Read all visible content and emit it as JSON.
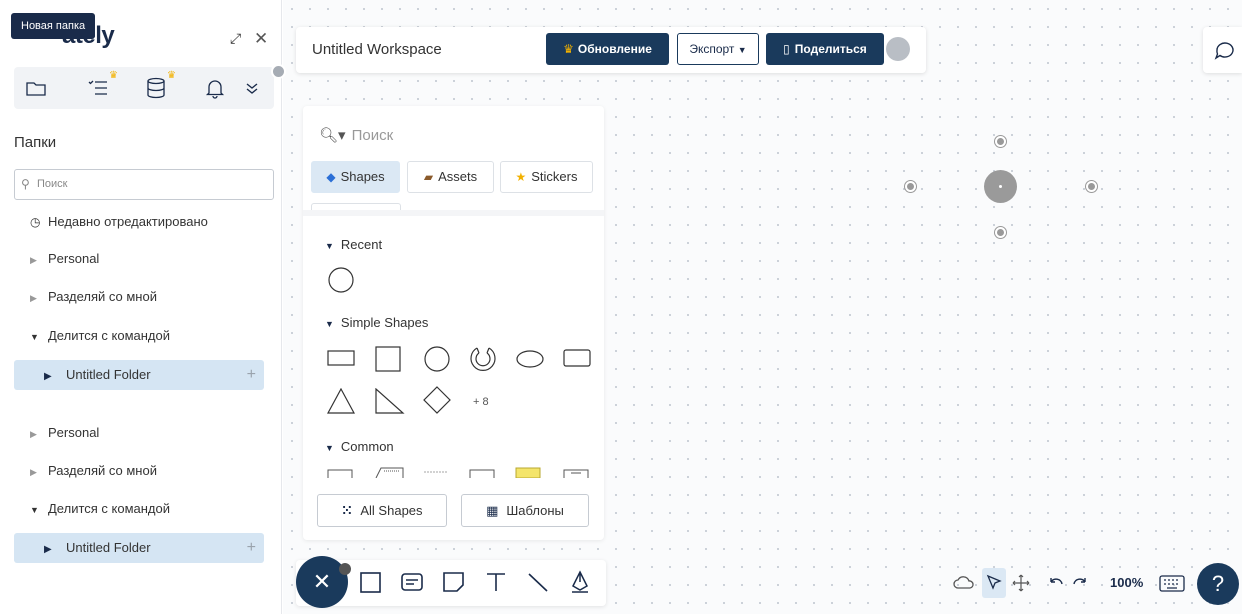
{
  "sidebar": {
    "tooltip": "Новая папка",
    "brand": "ately",
    "folders_title": "Папки",
    "search_placeholder": "Поиск",
    "recent": "Недавно отредактировано",
    "items": [
      {
        "label": "Personal",
        "state": "collapsed"
      },
      {
        "label": "Разделяй со мной",
        "state": "collapsed"
      },
      {
        "label": "Делится с командой",
        "state": "open"
      },
      {
        "label": "Untitled Folder",
        "state": "selected"
      },
      {
        "label": "Personal",
        "state": "collapsed"
      },
      {
        "label": "Разделяй со мной",
        "state": "collapsed"
      },
      {
        "label": "Делится с командой",
        "state": "open"
      },
      {
        "label": "Untitled Folder",
        "state": "selected"
      }
    ],
    "add_symbol": "+"
  },
  "topbar": {
    "workspace_title": "Untitled Workspace",
    "upgrade_label": "Обновление",
    "export_label": "Экспорт",
    "share_label": "Поделиться"
  },
  "shapes_panel": {
    "search_placeholder": "Поиск",
    "tabs": {
      "shapes": "Shapes",
      "assets": "Assets",
      "stickers": "Stickers"
    },
    "sections": {
      "recent": "Recent",
      "simple": "Simple Shapes",
      "common": "Common"
    },
    "more_count": "+ 8",
    "all_shapes_label": "All Shapes",
    "templates_label": "Шаблоны"
  },
  "bottom_right": {
    "zoom": "100%",
    "help": "?"
  },
  "colors": {
    "primary": "#1a3a5c",
    "selected_bg": "#d5e5f3",
    "crown": "#f2b100",
    "sticky": "#f4e56b"
  }
}
